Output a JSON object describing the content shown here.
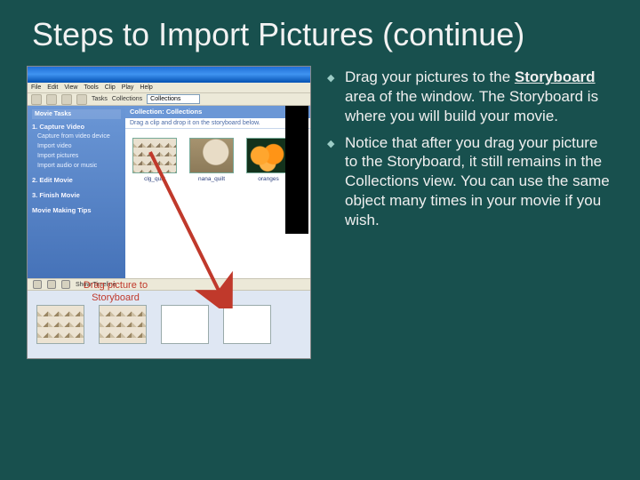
{
  "title": "Steps to Import Pictures (continue)",
  "bullets": {
    "b1_pre": "Drag your pictures to the ",
    "b1_bold": "Storyboard",
    "b1_post": " area of the window. The Storyboard is where you will build your movie.",
    "b2": "Notice that after you drag your picture to the Storyboard, it still remains in the Collections view. You can use the same object many times in your movie if you wish."
  },
  "screenshot": {
    "menus": {
      "m0": "File",
      "m1": "Edit",
      "m2": "View",
      "m3": "Tools",
      "m4": "Clip",
      "m5": "Play",
      "m6": "Help"
    },
    "toolbar": {
      "tasks_label": "Tasks",
      "coll_label": "Collections",
      "dropdown": "Collections"
    },
    "sidebar": {
      "header": "Movie Tasks",
      "g1": "1. Capture Video",
      "g1a": "Capture from video device",
      "g1b": "Import video",
      "g1c": "Import pictures",
      "g1d": "Import audio or music",
      "g2": "2. Edit Movie",
      "g3": "3. Finish Movie",
      "tips": "Movie Making Tips"
    },
    "main": {
      "header": "Collection: Collections",
      "sub": "Drag a clip and drop it on the storyboard below."
    },
    "thumbs": {
      "t1": "clg_quilt",
      "t2": "nana_quilt",
      "t3": "oranges"
    },
    "drag_label_l1": "Drag picture to",
    "drag_label_l2": "Storyboard",
    "storyboard_btn": "Show Timeline"
  }
}
